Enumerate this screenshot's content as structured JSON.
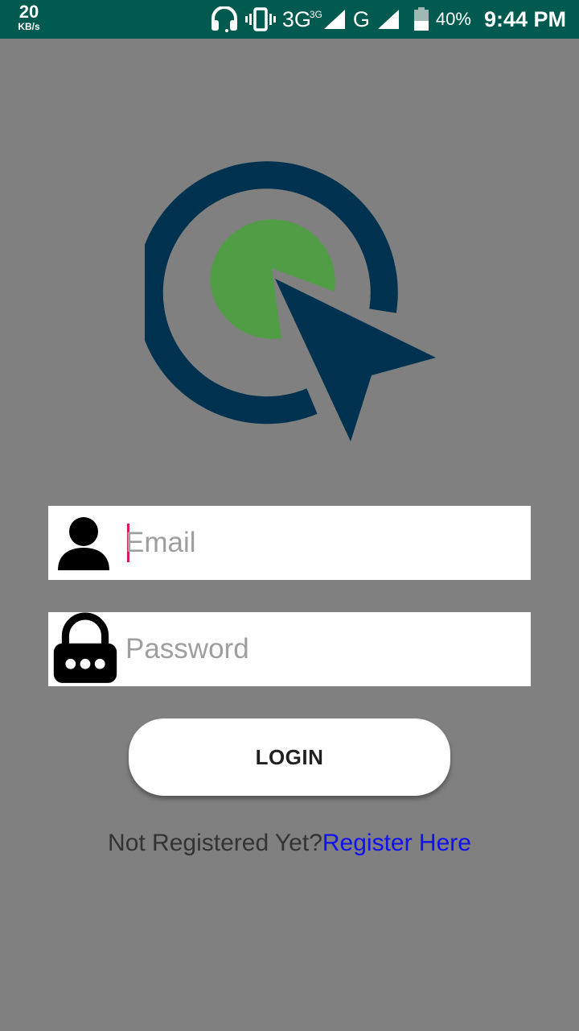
{
  "status_bar": {
    "speed_value": "20",
    "speed_unit": "KB/s",
    "network_3g": "3G",
    "network_3g_sup": "3G",
    "network_g": "G",
    "battery_percent": "40%",
    "time": "9:44 PM"
  },
  "colors": {
    "status_bar_bg": "#005a4f",
    "background": "#808080",
    "logo_navy": "#00324f",
    "logo_green": "#519d46",
    "cursor_accent": "#d81b60",
    "link": "#1010f0"
  },
  "login_form": {
    "email_placeholder": "Email",
    "password_placeholder": "Password",
    "login_label": "LOGIN",
    "not_registered_text": "Not Registered Yet?",
    "register_link": "Register Here"
  },
  "icons": {
    "headset": "headset-icon",
    "vibrate": "vibrate-icon",
    "signal": "signal-icon",
    "battery": "battery-icon",
    "user": "user-icon",
    "lock": "lock-icon",
    "logo": "app-logo"
  }
}
